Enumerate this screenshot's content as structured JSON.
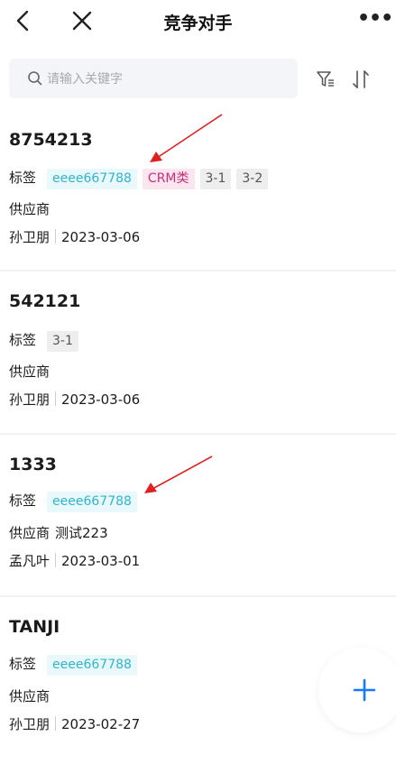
{
  "header": {
    "title": "竞争对手"
  },
  "search": {
    "placeholder": "请输入关键字"
  },
  "cards": [
    {
      "name": "8754213",
      "tag_label": "标签",
      "tags": [
        "eeee667788",
        "CRM类",
        "3-1",
        "3-2"
      ],
      "supplier_label": "供应商",
      "supplier_value": "",
      "owner": "孙卫朋",
      "date": "2023-03-06"
    },
    {
      "name": "542121",
      "tag_label": "标签",
      "tags": [
        "3-1"
      ],
      "supplier_label": "供应商",
      "supplier_value": "",
      "owner": "孙卫朋",
      "date": "2023-03-06"
    },
    {
      "name": "1333",
      "tag_label": "标签",
      "tags": [
        "eeee667788"
      ],
      "supplier_label": "供应商",
      "supplier_value": "测试223",
      "owner": "孟凡叶",
      "date": "2023-03-01"
    },
    {
      "name": "TANJI",
      "tag_label": "标签",
      "tags": [
        "eeee667788"
      ],
      "supplier_label": "供应商",
      "supplier_value": "",
      "owner": "孙卫朋",
      "date": "2023-02-27"
    }
  ],
  "colors": {
    "accent": "#1677ff",
    "tag_cyan": "#31b5cc",
    "tag_pink": "#c4317a",
    "annotation_arrow": "#e02020"
  },
  "icons": [
    "back-chevron-icon",
    "close-icon",
    "more-icon",
    "search-icon",
    "filter-icon",
    "sort-icon",
    "plus-icon"
  ]
}
